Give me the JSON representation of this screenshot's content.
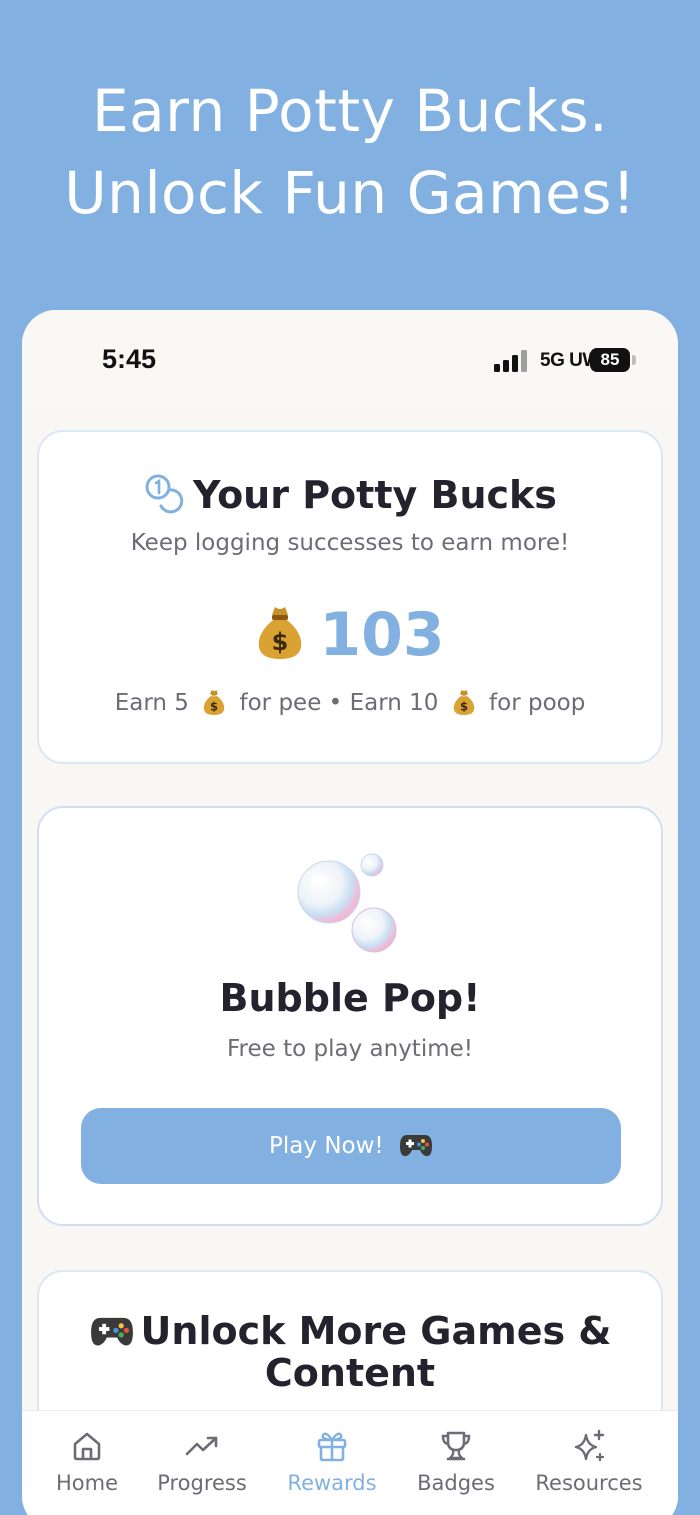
{
  "headline": {
    "line1": "Earn Potty Bucks.",
    "line2": "Unlock Fun Games!"
  },
  "status_bar": {
    "time": "5:45",
    "network": "5G UW",
    "battery": "85"
  },
  "bucks_card": {
    "title": "Your Potty Bucks",
    "subtitle": "Keep logging successes to earn more!",
    "amount": "103",
    "rule_pee_prefix": "Earn 5",
    "rule_pee_suffix": "for pee",
    "separator": "•",
    "rule_poop_prefix": "Earn 10",
    "rule_poop_suffix": "for poop"
  },
  "game_card": {
    "title": "Bubble Pop!",
    "subtitle": "Free to play anytime!",
    "button_label": "Play Now!"
  },
  "unlock_card": {
    "title_line1": "Unlock More Games &",
    "title_line2": "Content"
  },
  "tabs": [
    {
      "label": "Home",
      "icon": "home-icon"
    },
    {
      "label": "Progress",
      "icon": "trending-up-icon"
    },
    {
      "label": "Rewards",
      "icon": "gift-icon",
      "active": true
    },
    {
      "label": "Badges",
      "icon": "trophy-icon"
    },
    {
      "label": "Resources",
      "icon": "sparkles-icon"
    }
  ],
  "colors": {
    "accent": "#82b1e1",
    "text_dark": "#24222d",
    "text_muted": "#6d6c75"
  }
}
